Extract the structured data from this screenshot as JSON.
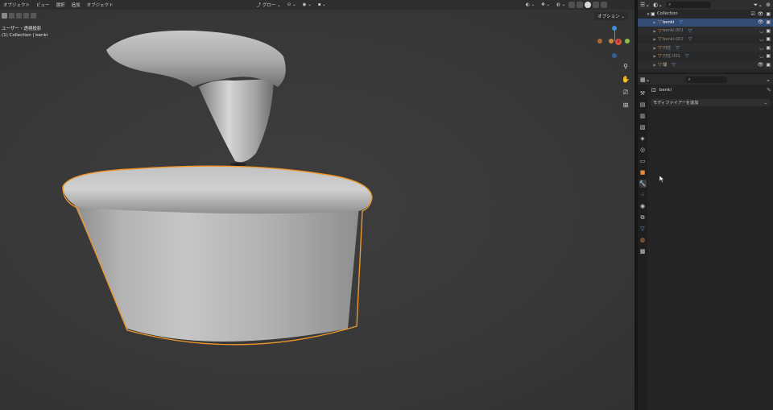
{
  "viewport": {
    "menu": [
      "オブジェクト",
      "ビュー",
      "選択",
      "追加",
      "オブジェクト"
    ],
    "transform_orientation": "グロー",
    "options_label": "オプション",
    "view_name": "ユーザー・透視投影",
    "collection_info": "(1) Collection | benki"
  },
  "gizmo": {
    "x_color": "#e0523f",
    "y_color": "#8ac24a",
    "z_color": "#3d8fd6",
    "x_label": "X"
  },
  "outliner": {
    "collection": "Collection",
    "items": [
      {
        "name": "benki",
        "selected": true,
        "hidden": false
      },
      {
        "name": "benki.001",
        "selected": false,
        "hidden": true
      },
      {
        "name": "benki.002",
        "selected": false,
        "hidden": true
      },
      {
        "name": "円柱",
        "selected": false,
        "hidden": true
      },
      {
        "name": "円柱.001",
        "selected": false,
        "hidden": true
      },
      {
        "name": "球",
        "selected": false,
        "hidden": false
      }
    ]
  },
  "properties": {
    "object_name": "benki",
    "add_modifier_label": "モディファイアーを追加"
  },
  "colors": {
    "selection_outline": "#f0962a",
    "selected_row": "#334c73",
    "accent_blue": "#5ea0e6"
  }
}
